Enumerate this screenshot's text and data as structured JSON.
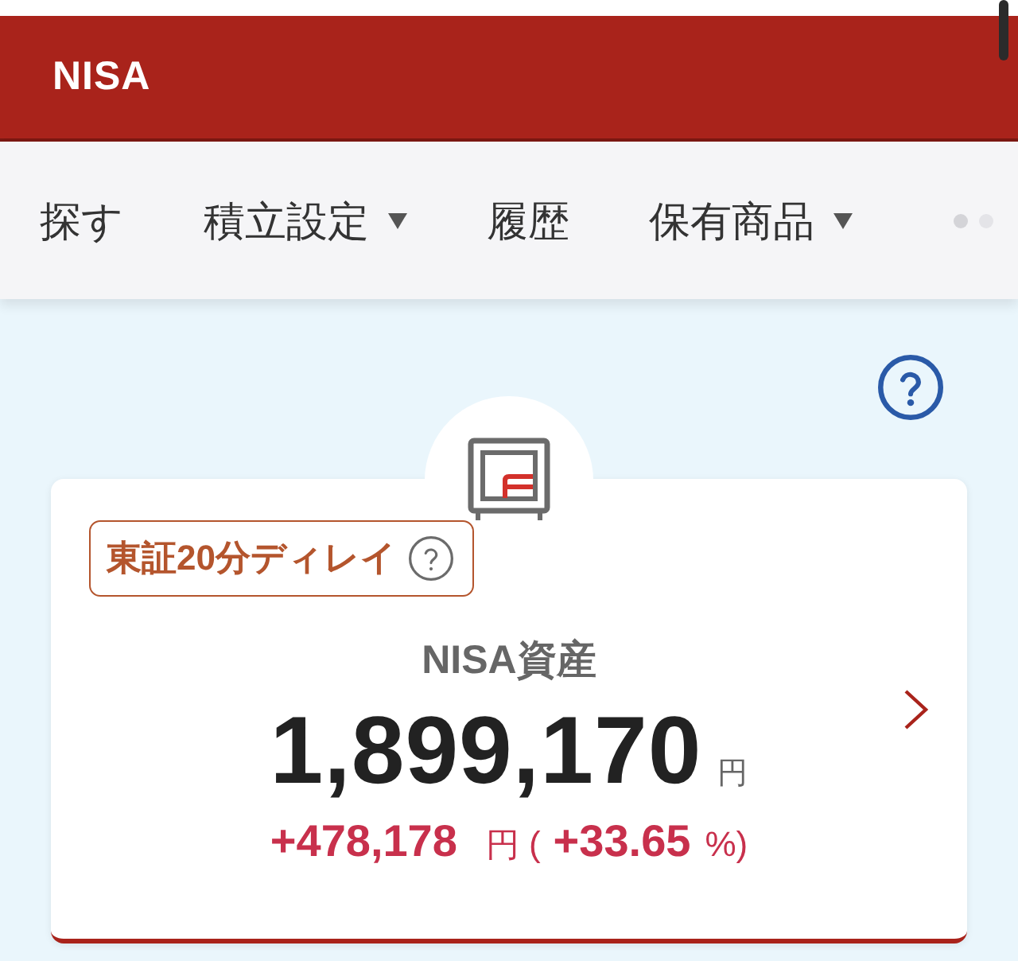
{
  "header": {
    "title": "NISA"
  },
  "nav": {
    "tabs": [
      {
        "label": "探す",
        "dropdown": false
      },
      {
        "label": "積立設定",
        "dropdown": true
      },
      {
        "label": "履歴",
        "dropdown": false
      },
      {
        "label": "保有商品",
        "dropdown": true
      }
    ]
  },
  "card": {
    "badge": "東証20分ディレイ",
    "title": "NISA資産",
    "amount": "1,899,170",
    "amount_unit": "円",
    "change": {
      "amount": "+478,178",
      "unit": "円",
      "open": "(",
      "percent": "+33.65",
      "close": "%)"
    }
  }
}
